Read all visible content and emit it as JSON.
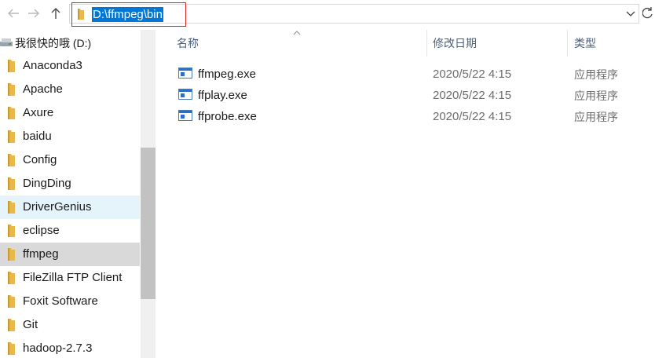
{
  "toolbar": {
    "back_icon": "arrow-left-icon",
    "forward_icon": "arrow-right-icon",
    "up_icon": "arrow-up-icon",
    "refresh_icon": "refresh-icon"
  },
  "address_bar": {
    "path": "D:\\ffmpeg\\bin",
    "dropdown_icon": "chevron-down-icon"
  },
  "sidebar": {
    "drive": {
      "label": "我很快的哦 (D:)",
      "icon": "drive-icon"
    },
    "items": [
      {
        "label": "Anaconda3",
        "icon": "folder-icon"
      },
      {
        "label": "Apache",
        "icon": "folder-icon"
      },
      {
        "label": "Axure",
        "icon": "folder-icon"
      },
      {
        "label": "baidu",
        "icon": "folder-icon"
      },
      {
        "label": "Config",
        "icon": "folder-icon"
      },
      {
        "label": "DingDing",
        "icon": "folder-icon"
      },
      {
        "label": "DriverGenius",
        "icon": "folder-icon",
        "state": "hover"
      },
      {
        "label": "eclipse",
        "icon": "folder-icon"
      },
      {
        "label": "ffmpeg",
        "icon": "folder-icon",
        "state": "selected"
      },
      {
        "label": "FileZilla FTP Client",
        "icon": "folder-icon"
      },
      {
        "label": "Foxit Software",
        "icon": "folder-icon"
      },
      {
        "label": "Git",
        "icon": "folder-icon"
      },
      {
        "label": "hadoop-2.7.3",
        "icon": "folder-icon"
      }
    ]
  },
  "file_list": {
    "columns": {
      "name": "名称",
      "modified": "修改日期",
      "type": "类型"
    },
    "rows": [
      {
        "name": "ffmpeg.exe",
        "modified": "2020/5/22 4:15",
        "type": "应用程序"
      },
      {
        "name": "ffplay.exe",
        "modified": "2020/5/22 4:15",
        "type": "应用程序"
      },
      {
        "name": "ffprobe.exe",
        "modified": "2020/5/22 4:15",
        "type": "应用程序"
      }
    ]
  },
  "colors": {
    "selection": "#0078d7",
    "highlight_box": "#e02020",
    "hover": "#e5f3fb",
    "selected": "#d9d9d9",
    "folder": "#e8b94a"
  }
}
